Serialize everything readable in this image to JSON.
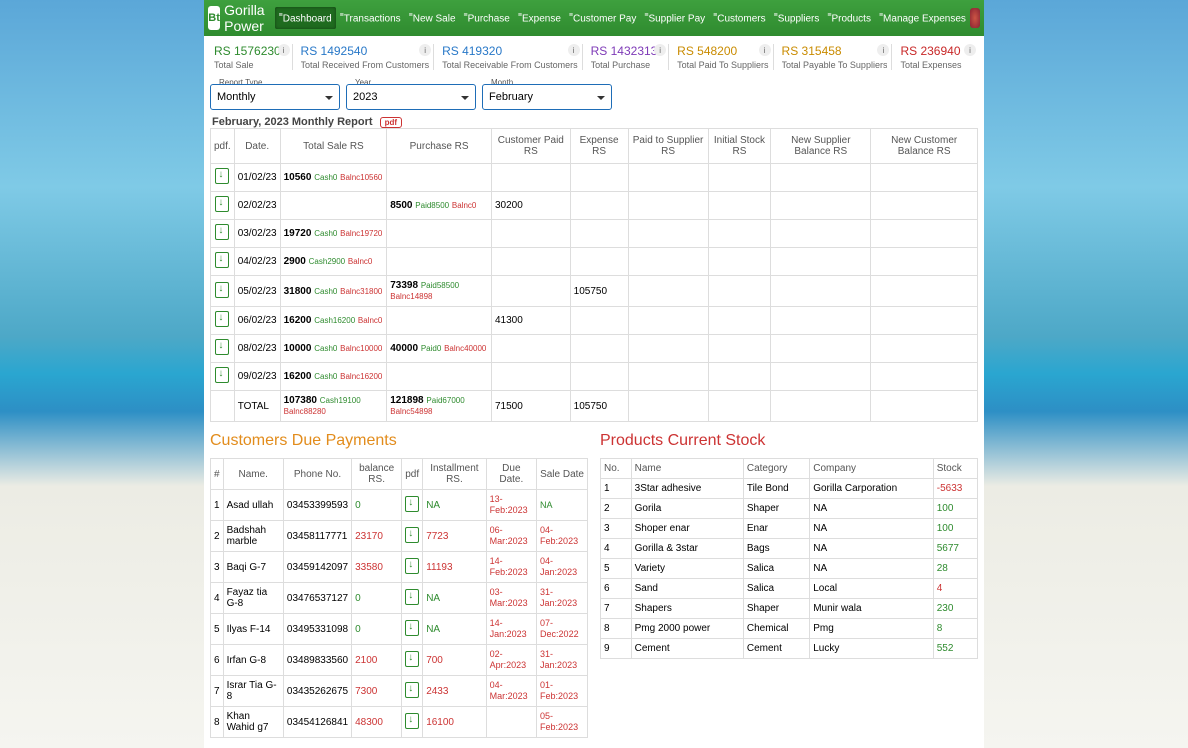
{
  "brand": "Gorilla Power",
  "nav": [
    "Dashboard",
    "Transactions",
    "New Sale",
    "Purchase",
    "Expense",
    "Customer Pay",
    "Supplier Pay",
    "Customers",
    "Suppliers",
    "Products",
    "Manage Expenses"
  ],
  "stats": [
    {
      "cls": "c-totalSale",
      "value": "RS 1576230",
      "label": "Total Sale"
    },
    {
      "cls": "c-recv",
      "value": "RS 1492540",
      "label": "Total Received From Customers"
    },
    {
      "cls": "c-receivable",
      "value": "RS 419320",
      "label": "Total Receivable From Customers"
    },
    {
      "cls": "c-purchase",
      "value": "RS 1432313",
      "label": "Total Purchase"
    },
    {
      "cls": "c-paid",
      "value": "RS 548200",
      "label": "Total Paid To Suppliers"
    },
    {
      "cls": "c-payable",
      "value": "RS 315458",
      "label": "Total Payable To Suppliers"
    },
    {
      "cls": "c-expense",
      "value": "RS 236940",
      "label": "Total Expenses"
    }
  ],
  "filters": {
    "reportType": {
      "label": "Report Type",
      "value": "Monthly"
    },
    "year": {
      "label": "Year",
      "value": "2023"
    },
    "month": {
      "label": "Month",
      "value": "February"
    }
  },
  "reportTitle": "February, 2023 Monthly Report",
  "reportHeaders": [
    "pdf.",
    "Date.",
    "Total Sale RS",
    "Purchase RS",
    "Customer Paid RS",
    "Expense RS",
    "Paid to Supplier RS",
    "Initial Stock RS",
    "New Supplier Balance RS",
    "New Customer Balance RS"
  ],
  "reportRows": [
    {
      "date": "01/02/23",
      "sale": "10560",
      "saleCash": "0",
      "saleBal": "10560"
    },
    {
      "date": "02/02/23",
      "purchase": "8500",
      "purPaid": "8500",
      "purBal": "0",
      "cpaid": "30200"
    },
    {
      "date": "03/02/23",
      "sale": "19720",
      "saleCash": "0",
      "saleBal": "19720"
    },
    {
      "date": "04/02/23",
      "sale": "2900",
      "saleCash": "2900",
      "saleBal": "0"
    },
    {
      "date": "05/02/23",
      "sale": "31800",
      "saleCash": "0",
      "saleBal": "31800",
      "purchase": "73398",
      "purPaid": "58500",
      "purBal": "14898",
      "expense": "105750"
    },
    {
      "date": "06/02/23",
      "sale": "16200",
      "saleCash": "16200",
      "saleBal": "0",
      "cpaid": "41300"
    },
    {
      "date": "08/02/23",
      "sale": "10000",
      "saleCash": "0",
      "saleBal": "10000",
      "purchase": "40000",
      "purPaid": "0",
      "purBal": "40000"
    },
    {
      "date": "09/02/23",
      "sale": "16200",
      "saleCash": "0",
      "saleBal": "16200"
    }
  ],
  "reportTotal": {
    "label": "TOTAL",
    "sale": "107380",
    "saleCash": "19100",
    "saleBal": "88280",
    "purchase": "121898",
    "purPaid": "67000",
    "purBal": "54898",
    "cpaid": "71500",
    "expense": "105750"
  },
  "custPanelTitle": "Customers Due Payments",
  "custHeaders": [
    "#",
    "Name.",
    "Phone No.",
    "balance RS.",
    "pdf",
    "Installment RS.",
    "Due Date.",
    "Sale Date"
  ],
  "custRows": [
    {
      "n": "1",
      "name": "Asad ullah",
      "phone": "03453399593",
      "bal": "0",
      "balClr": "green",
      "inst": "NA",
      "instClr": "green",
      "due": "13-Feb:2023",
      "dueClr": "red",
      "sale": "NA",
      "saleClr": "green"
    },
    {
      "n": "2",
      "name": "Badshah marble",
      "phone": "03458117771",
      "bal": "23170",
      "balClr": "red",
      "inst": "7723",
      "instClr": "red",
      "due": "06-Mar:2023",
      "dueClr": "red",
      "sale": "04-Feb:2023",
      "saleClr": "red"
    },
    {
      "n": "3",
      "name": "Baqi G-7",
      "phone": "03459142097",
      "bal": "33580",
      "balClr": "red",
      "inst": "11193",
      "instClr": "red",
      "due": "14-Feb:2023",
      "dueClr": "red",
      "sale": "04-Jan:2023",
      "saleClr": "red"
    },
    {
      "n": "4",
      "name": "Fayaz tia G-8",
      "phone": "03476537127",
      "bal": "0",
      "balClr": "green",
      "inst": "NA",
      "instClr": "green",
      "due": "03-Mar:2023",
      "dueClr": "red",
      "sale": "31-Jan:2023",
      "saleClr": "red"
    },
    {
      "n": "5",
      "name": "Ilyas F-14",
      "phone": "03495331098",
      "bal": "0",
      "balClr": "green",
      "inst": "NA",
      "instClr": "green",
      "due": "14-Jan:2023",
      "dueClr": "red",
      "sale": "07-Dec:2022",
      "saleClr": "red"
    },
    {
      "n": "6",
      "name": "Irfan G-8",
      "phone": "03489833560",
      "bal": "2100",
      "balClr": "red",
      "inst": "700",
      "instClr": "red",
      "due": "02-Apr:2023",
      "dueClr": "red",
      "sale": "31-Jan:2023",
      "saleClr": "red"
    },
    {
      "n": "7",
      "name": "Israr Tia G-8",
      "phone": "03435262675",
      "bal": "7300",
      "balClr": "red",
      "inst": "2433",
      "instClr": "red",
      "due": "04-Mar:2023",
      "dueClr": "red",
      "sale": "01-Feb:2023",
      "saleClr": "red"
    },
    {
      "n": "8",
      "name": "Khan Wahid g7",
      "phone": "03454126841",
      "bal": "48300",
      "balClr": "red",
      "inst": "16100",
      "instClr": "red",
      "due": "",
      "dueClr": "",
      "sale": "05-Feb:2023",
      "saleClr": "red"
    }
  ],
  "stockPanelTitle": "Products Current Stock",
  "stockHeaders": [
    "No.",
    "Name",
    "Category",
    "Company",
    "Stock"
  ],
  "stockRows": [
    {
      "n": "1",
      "name": "3Star adhesive",
      "cat": "Tile Bond",
      "co": "Gorilla Carporation",
      "stock": "-5633",
      "clr": "red"
    },
    {
      "n": "2",
      "name": "Gorila",
      "cat": "Shaper",
      "co": "NA",
      "stock": "100",
      "clr": "green"
    },
    {
      "n": "3",
      "name": "Shoper enar",
      "cat": "Enar",
      "co": "NA",
      "stock": "100",
      "clr": "green"
    },
    {
      "n": "4",
      "name": "Gorilla & 3star",
      "cat": "Bags",
      "co": "NA",
      "stock": "5677",
      "clr": "green"
    },
    {
      "n": "5",
      "name": "Variety",
      "cat": "Salica",
      "co": "NA",
      "stock": "28",
      "clr": "green"
    },
    {
      "n": "6",
      "name": "Sand",
      "cat": "Salica",
      "co": "Local",
      "stock": "4",
      "clr": "red"
    },
    {
      "n": "7",
      "name": "Shapers",
      "cat": "Shaper",
      "co": "Munir wala",
      "stock": "230",
      "clr": "green"
    },
    {
      "n": "8",
      "name": "Pmg 2000 power",
      "cat": "Chemical",
      "co": "Pmg",
      "stock": "8",
      "clr": "green"
    },
    {
      "n": "9",
      "name": "Cement",
      "cat": "Cement",
      "co": "Lucky",
      "stock": "552",
      "clr": "green"
    }
  ]
}
